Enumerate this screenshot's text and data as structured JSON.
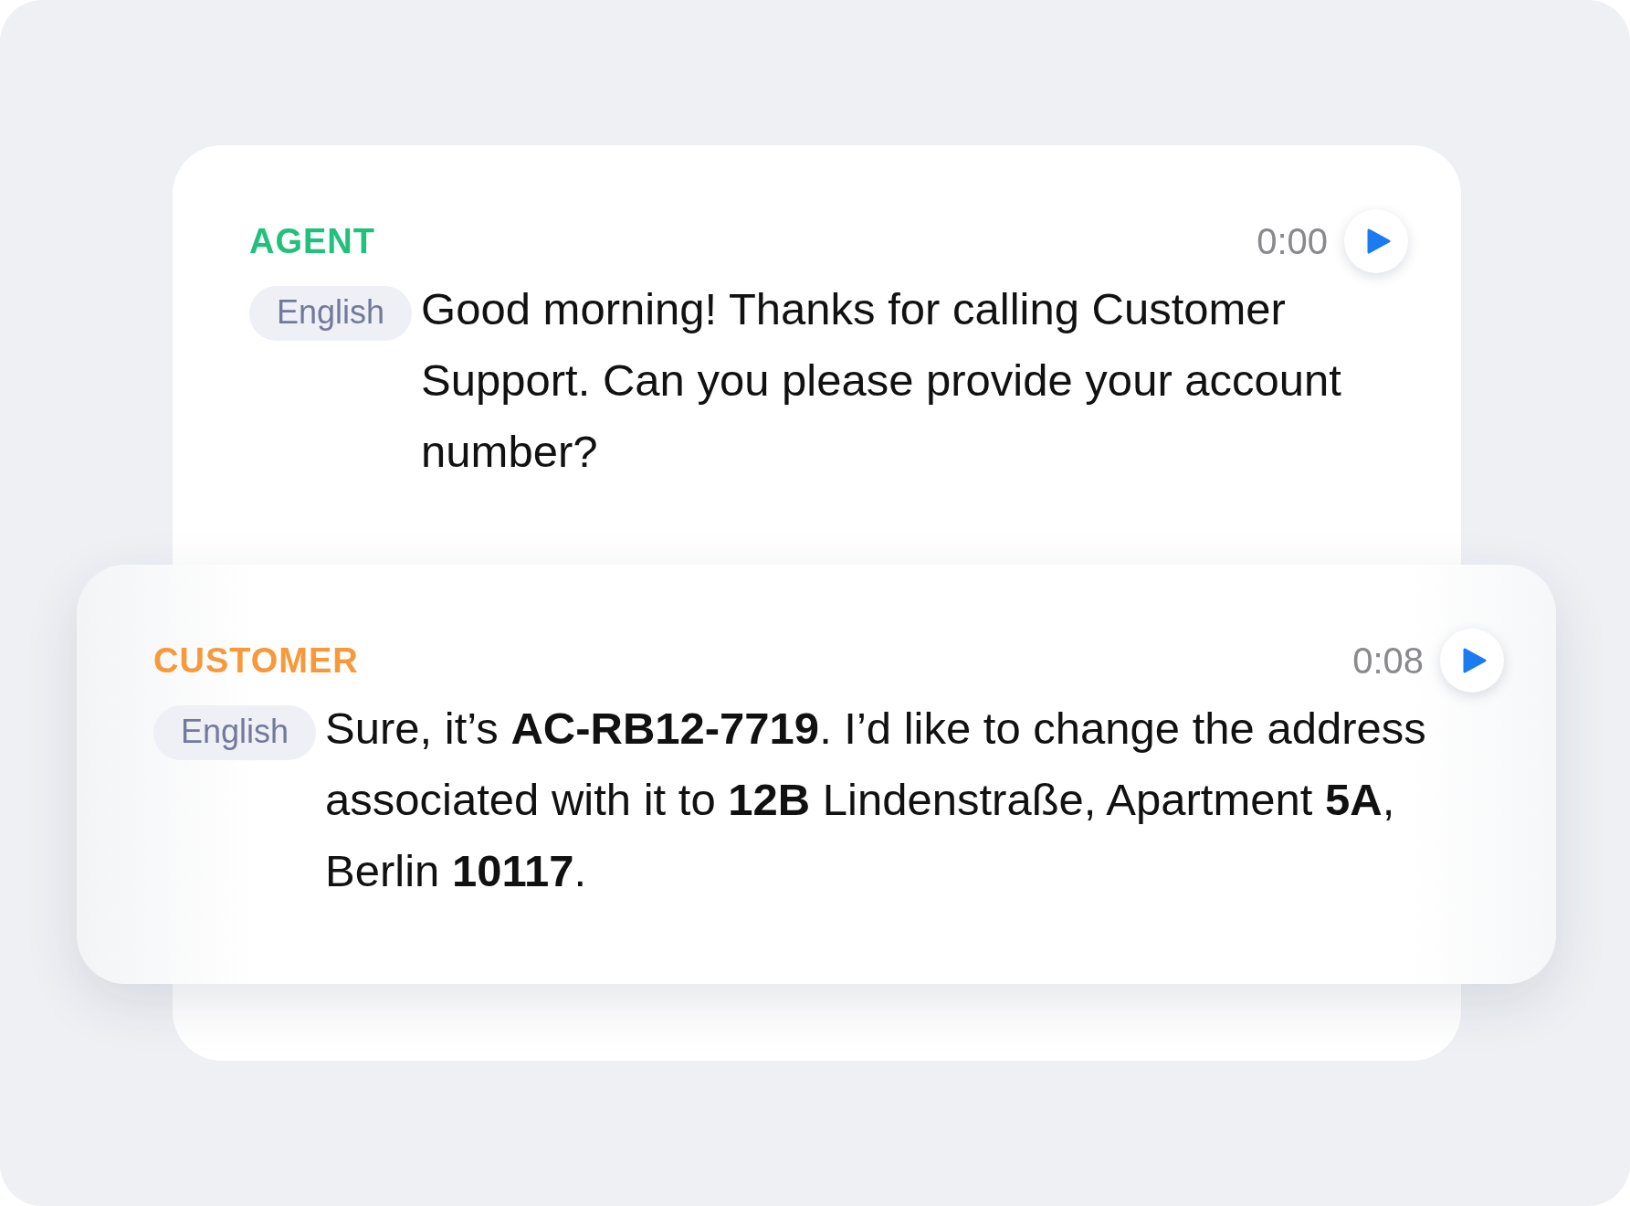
{
  "messages": [
    {
      "speaker": "AGENT",
      "color": "#22c17a",
      "time": "0:00",
      "language": "English",
      "text": "Good morning! Thanks for calling Customer Support. Can you please provide your account number?"
    },
    {
      "speaker": "CUSTOMER",
      "color": "#f7993a",
      "time": "0:08",
      "language": "English",
      "text": "Sure, it’s **AC-RB12-7719**. I’d like to change the address associated with it to **12B** Lindenstraße, Apartment **5A**, Berlin **10117**."
    }
  ]
}
